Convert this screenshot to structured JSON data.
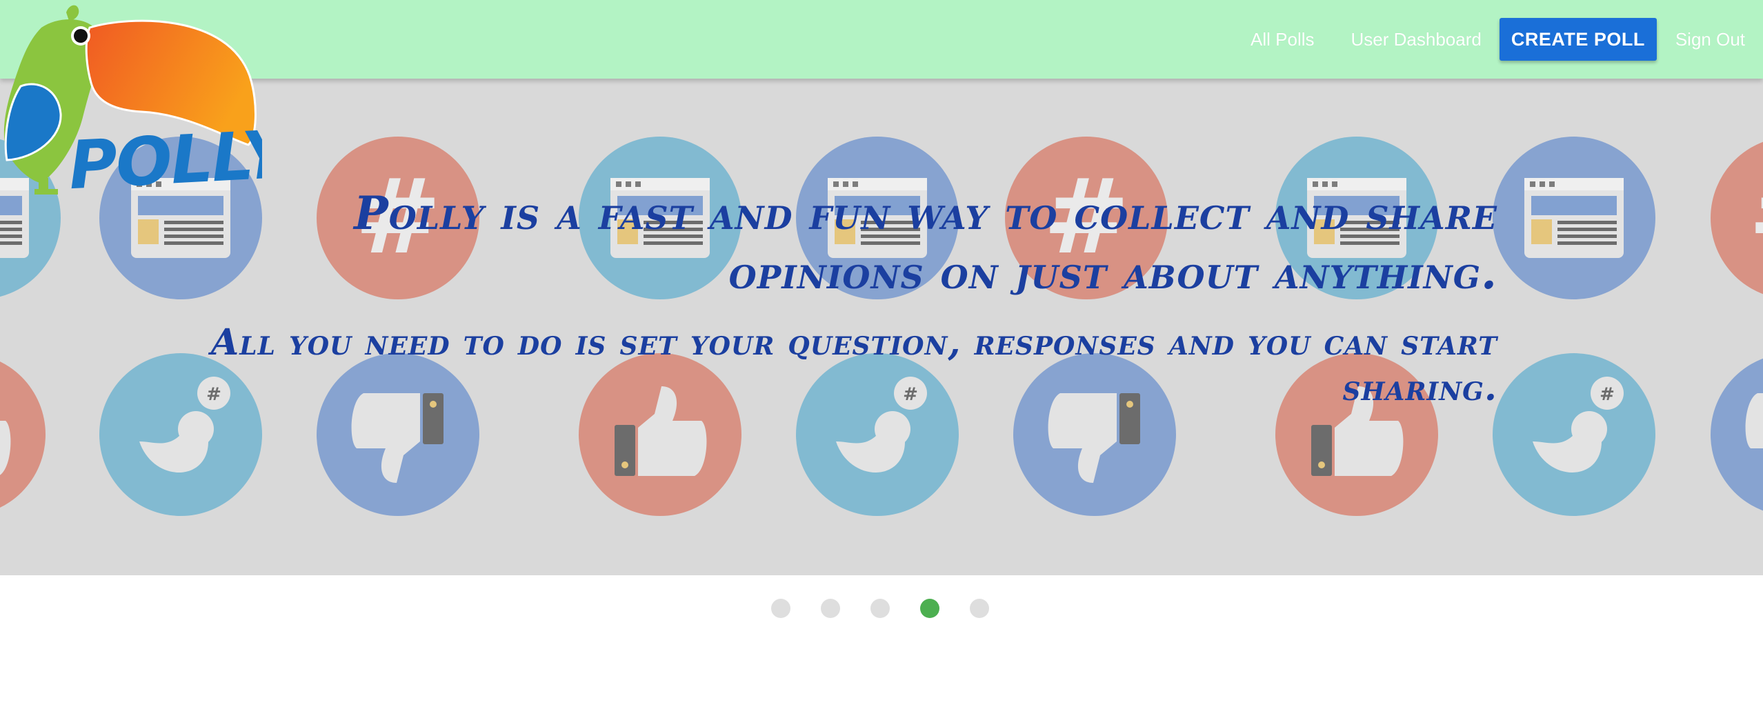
{
  "brand": {
    "logo_text": "POLLY"
  },
  "nav": {
    "all_polls": "All Polls",
    "user_dashboard": "User Dashboard",
    "create_poll": "CREATE POLL",
    "sign_out": "Sign Out"
  },
  "hero": {
    "tagline": "Polly is a fast and fun way to collect and share opinions on just about anything.",
    "subline": "All you need to do is set your question, responses and you can start sharing."
  },
  "carousel": {
    "slide_count": 5,
    "active_slide": 4
  },
  "colors": {
    "header_bg": "#b3f3c4",
    "accent_button": "#1a6fd8",
    "hero_text": "#1b3fa0",
    "dot_active": "#4caf50",
    "dot_inactive": "#dedede"
  }
}
